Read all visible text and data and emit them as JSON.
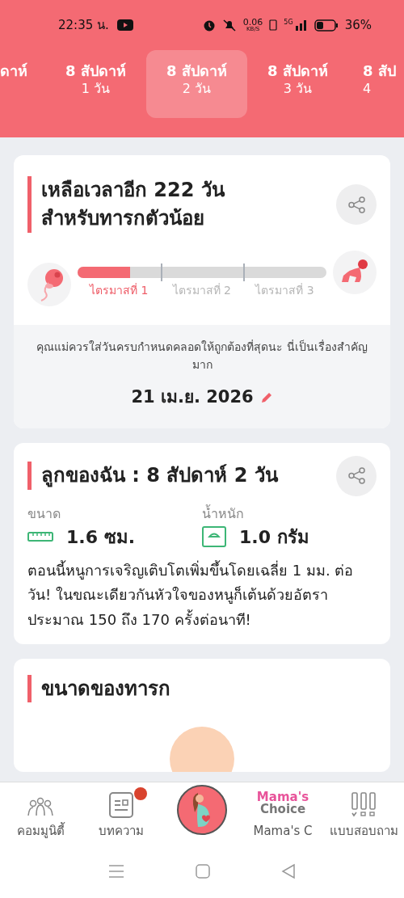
{
  "status_bar": {
    "time": "22:35 น.",
    "speed": "0.06",
    "speed_unit": "KB/S",
    "network": "5G",
    "battery": "36%"
  },
  "week_tabs": [
    {
      "week": "ดาห์",
      "selected": false
    },
    {
      "week": "8 สัปดาห์",
      "day": "1 วัน",
      "selected": false
    },
    {
      "week": "8 สัปดาห์",
      "day": "2 วัน",
      "selected": true
    },
    {
      "week": "8 สัปดาห์",
      "day": "3 วัน",
      "selected": false
    },
    {
      "week": "8 สัป",
      "day": "4",
      "selected": false
    }
  ],
  "countdown_card": {
    "title": "เหลือเวลาอีก 222 วัน สำหรับทารกตัวน้อย",
    "level": 0.21,
    "trimesters": [
      {
        "label": "ไตรมาสที่ 1",
        "selected": true
      },
      {
        "label": "ไตรมาสที่ 2",
        "selected": false
      },
      {
        "label": "ไตรมาสที่ 3",
        "selected": false
      }
    ],
    "note": "คุณแม่ควรใส่วันครบกำหนดคลอดให้ถูกต้องที่สุดนะ นี่เป็นเรื่องสำคัญมาก",
    "due_date": "21 เม.ย. 2026"
  },
  "baby_card": {
    "title": "ลูกของฉัน : 8 สัปดาห์ 2  วัน",
    "stats": [
      {
        "kind": "size",
        "label": "ขนาด",
        "value": "1.6 ซม."
      },
      {
        "kind": "weight",
        "label": "น้ำหนัก",
        "value": "1.0 กรัม"
      }
    ],
    "description": "ตอนนี้หนูการเจริญเติบโตเพิ่มขึ้นโดยเฉลี่ย 1 มม. ต่อวัน! ในขณะเดียวกันหัวใจของหนูก็เต้นด้วยอัตราประมาณ 150 ถึง 170 ครั้งต่อนาที!"
  },
  "size_card": {
    "title": "ขนาดของทารก"
  },
  "bottom_nav": [
    {
      "kind": "community",
      "label": "คอมมูนิตี้",
      "badge": false
    },
    {
      "kind": "articles",
      "label": "บทความ",
      "badge": true
    },
    {
      "kind": "center",
      "badge": false
    },
    {
      "kind": "brand",
      "logo_top": "Mama's",
      "logo_bottom": "Choice",
      "label": "Mama's C",
      "badge": false
    },
    {
      "kind": "quiz",
      "label": "แบบสอบถาม",
      "badge": false
    }
  ]
}
